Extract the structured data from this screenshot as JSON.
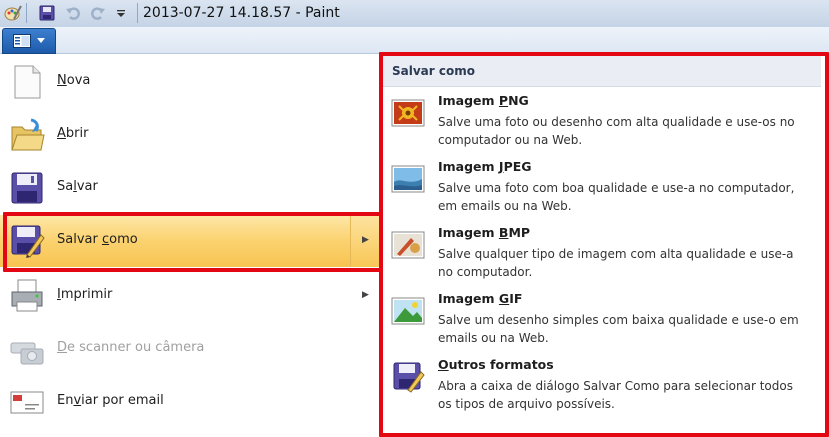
{
  "window": {
    "title": "2013-07-27 14.18.57 - Paint"
  },
  "quick_access": {
    "icons": [
      "paint-icon",
      "save-icon",
      "undo-icon",
      "redo-icon",
      "customize-icon"
    ]
  },
  "app_menu": {
    "items": [
      {
        "key": "N",
        "rest": "ova",
        "pre": "",
        "icon": "new-file-icon",
        "enabled": true,
        "submenu": false
      },
      {
        "key": "A",
        "rest": "brir",
        "pre": "",
        "icon": "open-folder-icon",
        "enabled": true,
        "submenu": false
      },
      {
        "key": "l",
        "rest": "var",
        "pre": "Sa",
        "icon": "save-icon",
        "enabled": true,
        "submenu": false
      },
      {
        "key": "c",
        "rest": "omo",
        "pre": "Salvar ",
        "icon": "save-as-icon",
        "enabled": true,
        "submenu": true
      },
      {
        "key": "I",
        "rest": "mprimir",
        "pre": "",
        "icon": "printer-icon",
        "enabled": true,
        "submenu": true
      },
      {
        "key": "D",
        "rest": "e scanner ou câmera",
        "pre": "",
        "icon": "scanner-camera-icon",
        "enabled": false,
        "submenu": false
      },
      {
        "key": "v",
        "rest": "iar por email",
        "pre": "En",
        "icon": "email-icon",
        "enabled": true,
        "submenu": false
      }
    ]
  },
  "save_as_panel": {
    "header": "Salvar como",
    "items": [
      {
        "pre": "Imagem ",
        "key": "P",
        "rest": "NG",
        "desc": "Salve uma foto ou desenho com alta qualidade e use-os no computador ou na Web.",
        "icon": "png-image-icon"
      },
      {
        "pre": "Imagem ",
        "key": "J",
        "rest": "PEG",
        "desc": "Salve uma foto com boa qualidade e use-a no computador, em emails ou na Web.",
        "icon": "jpeg-image-icon"
      },
      {
        "pre": "Imagem ",
        "key": "B",
        "rest": "MP",
        "desc": "Salve qualquer tipo de imagem com alta qualidade e use-a no computador.",
        "icon": "bmp-image-icon"
      },
      {
        "pre": "Imagem ",
        "key": "G",
        "rest": "IF",
        "desc": "Salve um desenho simples com baixa qualidade e use-o em emails ou na Web.",
        "icon": "gif-image-icon"
      },
      {
        "pre": "",
        "key": "O",
        "rest": "utros formatos",
        "desc": "Abra a caixa de diálogo Salvar Como para selecionar todos os tipos de arquivo possíveis.",
        "icon": "other-formats-icon"
      }
    ]
  },
  "colors": {
    "highlight_red": "#e30613",
    "hover_orange": "#fbd26f",
    "app_button_blue": "#1d5aaa"
  }
}
